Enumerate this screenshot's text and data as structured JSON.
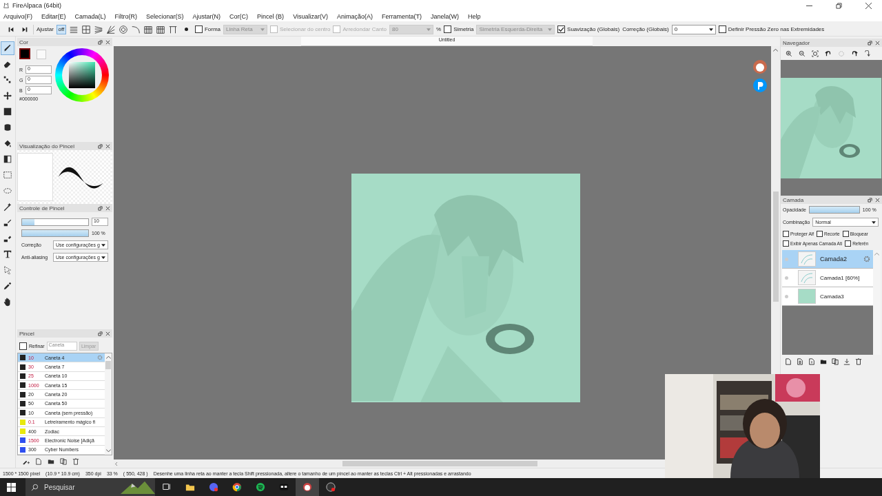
{
  "window": {
    "title": "FireAlpaca (64bit)"
  },
  "menu": [
    "Arquivo(F)",
    "Editar(E)",
    "Camada(L)",
    "Filtro(R)",
    "Selecionar(S)",
    "Ajustar(N)",
    "Cor(C)",
    "Pincel (B)",
    "Visualizar(V)",
    "Animação(A)",
    "Ferramenta(T)",
    "Janela(W)",
    "Help"
  ],
  "toolbar": {
    "adjust_label": "Ajustar",
    "snaps": [
      {
        "kind": "off",
        "label": "off",
        "selected": true
      },
      {
        "kind": "parallel",
        "selected": false
      },
      {
        "kind": "cross",
        "selected": false
      },
      {
        "kind": "vanishing",
        "selected": false
      },
      {
        "kind": "radial",
        "selected": false
      },
      {
        "kind": "concentric",
        "selected": false
      },
      {
        "kind": "curve",
        "selected": false
      },
      {
        "kind": "grid",
        "selected": false
      },
      {
        "kind": "grid",
        "selected": false
      },
      {
        "kind": "frame",
        "selected": false
      }
    ],
    "controls": [
      {
        "kind": "checkbox",
        "label": "Forma",
        "checked": false,
        "disabled": false
      },
      {
        "kind": "select",
        "value": "Linha Reta",
        "disabled": true
      },
      {
        "kind": "checkbox",
        "label": "Selecionar do centro",
        "checked": false,
        "disabled": true
      },
      {
        "kind": "checkbox",
        "label": "Arredondar Canto",
        "checked": false,
        "disabled": true
      },
      {
        "kind": "select",
        "value": "80",
        "disabled": true
      },
      {
        "kind": "text",
        "label": "%"
      },
      {
        "kind": "checkbox",
        "label": "Simetria",
        "checked": false,
        "disabled": false
      },
      {
        "kind": "select",
        "value": "Simetria Esquerda-Direita",
        "disabled": true
      },
      {
        "kind": "checkbox",
        "label": "Suavização (Globais)",
        "checked": true,
        "disabled": false
      },
      {
        "kind": "text",
        "label": "Correção (Globais)"
      },
      {
        "kind": "select",
        "value": "0",
        "disabled": false
      },
      {
        "kind": "checkbox",
        "label": "Definir Pressão Zero nas Extremidades",
        "checked": false,
        "disabled": false
      }
    ]
  },
  "tools": [
    {
      "kind": "brush",
      "selected": true
    },
    {
      "kind": "eraser",
      "selected": false
    },
    {
      "kind": "dots",
      "selected": false
    },
    {
      "kind": "move",
      "selected": false
    },
    {
      "kind": "square",
      "selected": false
    },
    {
      "kind": "blob",
      "selected": false
    },
    {
      "kind": "bucket",
      "selected": false
    },
    {
      "kind": "gradient",
      "selected": false
    },
    {
      "kind": "rect-select",
      "selected": false
    },
    {
      "kind": "lasso",
      "selected": false
    },
    {
      "kind": "wand",
      "selected": false
    },
    {
      "kind": "pen-select",
      "selected": false
    },
    {
      "kind": "eraser-select",
      "selected": false
    },
    {
      "kind": "text",
      "selected": false
    },
    {
      "kind": "pointer",
      "selected": false
    },
    {
      "kind": "eyedropper",
      "selected": false
    },
    {
      "kind": "hand",
      "selected": false
    }
  ],
  "color_panel": {
    "title": "Cor",
    "hex": "#000000",
    "channels": [
      {
        "label": "R",
        "value": "0"
      },
      {
        "label": "G",
        "value": "0"
      },
      {
        "label": "B",
        "value": "0"
      }
    ]
  },
  "brush_preview": {
    "title": "Visualização do Pincel"
  },
  "brush_control": {
    "title": "Controle de Pincel",
    "size": {
      "level": 0.19,
      "value": "10"
    },
    "opacity": {
      "level": 1.0,
      "reading": "100 %"
    },
    "options": [
      {
        "label": "Correção",
        "value": "Use configurações g"
      },
      {
        "label": "Anti-aliasing",
        "value": "Use configurações g"
      }
    ]
  },
  "brush_panel": {
    "title": "Pincel",
    "refine": {
      "label": "Refinar",
      "checked": false
    },
    "filter": "Caneta",
    "clear": "Limpar",
    "brushes": [
      {
        "size": "10",
        "name": "Caneta 4",
        "color": "#222222",
        "size_pressure": true,
        "selected": true
      },
      {
        "size": "30",
        "name": "Caneta 7",
        "color": "#222222",
        "size_pressure": true,
        "selected": false
      },
      {
        "size": "25",
        "name": "Caneta 10",
        "color": "#222222",
        "size_pressure": true,
        "selected": false
      },
      {
        "size": "1000",
        "name": "Caneta 15",
        "color": "#222222",
        "size_pressure": true,
        "selected": false
      },
      {
        "size": "20",
        "name": "Caneta 20",
        "color": "#222222",
        "size_pressure": false,
        "selected": false
      },
      {
        "size": "50",
        "name": "Caneta 50",
        "color": "#222222",
        "size_pressure": false,
        "selected": false
      },
      {
        "size": "10",
        "name": "Caneta (sem pressão)",
        "color": "#222222",
        "size_pressure": false,
        "selected": false
      },
      {
        "size": "0.1",
        "name": "Letreiramento mágico fi",
        "color": "#e8e80c",
        "size_pressure": true,
        "selected": false
      },
      {
        "size": "400",
        "name": "Zodiac",
        "color": "#e8e80c",
        "size_pressure": false,
        "selected": false
      },
      {
        "size": "1500",
        "name": "Electronic Noise [Adiçã",
        "color": "#2f4ff0",
        "size_pressure": true,
        "selected": false
      },
      {
        "size": "300",
        "name": "Cyber Numbers",
        "color": "#2f4ff0",
        "size_pressure": false,
        "selected": false
      }
    ]
  },
  "canvas": {
    "tab": "Untitled"
  },
  "navigator": {
    "title": "Navegador"
  },
  "layer_panel": {
    "title": "Camada",
    "opacity_label": "Opacidade",
    "opacity": {
      "level": 1.0,
      "reading": "100 %"
    },
    "blend_label": "Combinação",
    "blend": "Normal",
    "options": [
      {
        "label": "Proteger Alf",
        "checked": false
      },
      {
        "label": "Recorte",
        "checked": false
      },
      {
        "label": "Bloquear",
        "checked": false
      },
      {
        "label": "Exibir Apenas Camada Ati",
        "checked": false
      },
      {
        "label": "Referên",
        "checked": false
      }
    ],
    "layers": [
      {
        "name": "Camada2",
        "selected": true,
        "kind": "sketch"
      },
      {
        "name": "Camada1 [60%]",
        "selected": false,
        "kind": "sketch"
      },
      {
        "name": "Camada3",
        "selected": false,
        "kind": "fill"
      }
    ]
  },
  "status_bar": {
    "size": "1500 * 1500 pixel",
    "physical": "(10.9 * 10.9 cm)",
    "dpi": "350 dpi",
    "zoom": "33 %",
    "cursor": "( 550, 428 )",
    "hint": "Desenhe uma linha reta ao manter a tecla Shift pressionada, altere o tamanho de um pincel ao manter as teclas Ctrl + Alt pressionadas e arrastando"
  },
  "taskbar": {
    "search_placeholder": "Pesquisar"
  }
}
